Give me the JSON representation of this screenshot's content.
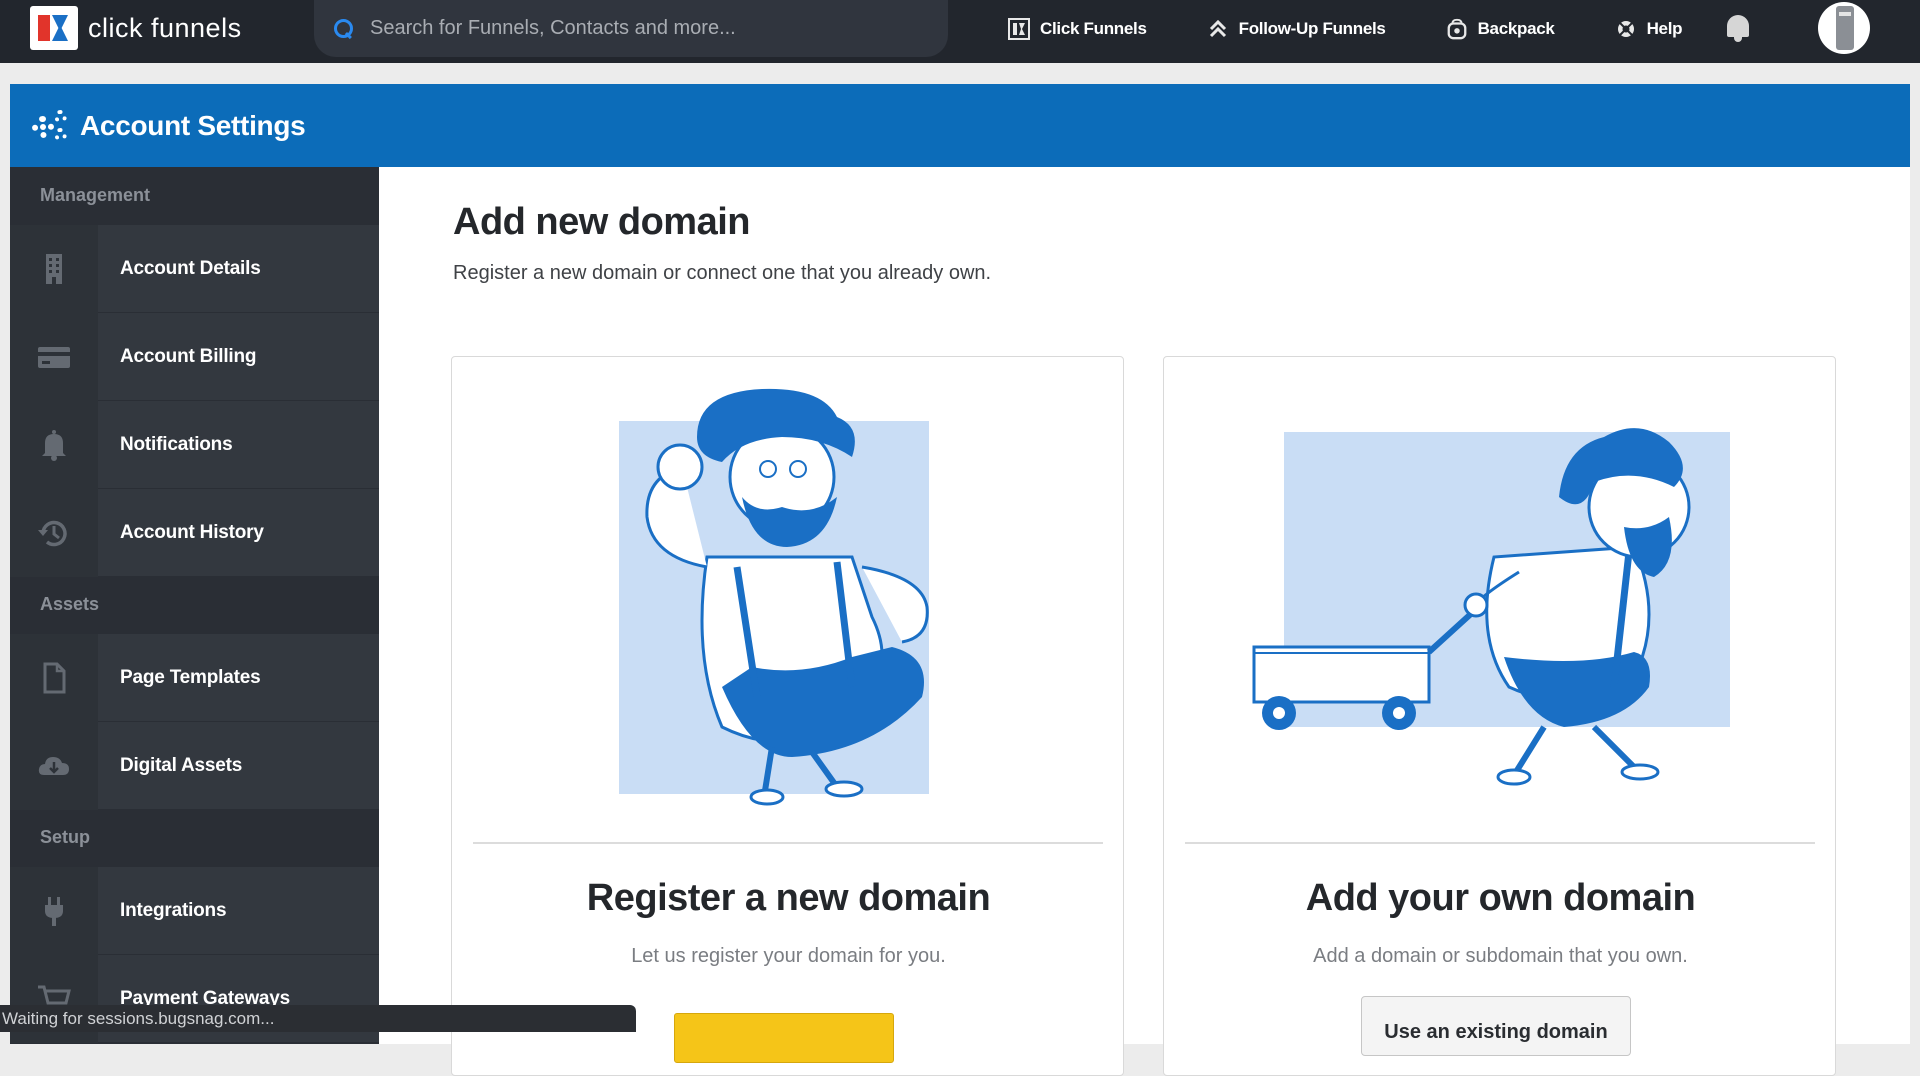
{
  "topbar": {
    "logo_text": "click funnels",
    "search_placeholder": "Search for Funnels, Contacts and more...",
    "nav": [
      {
        "label": "Click Funnels",
        "icon": "funnel-logo-icon"
      },
      {
        "label": "Follow-Up Funnels",
        "icon": "double-chevron-up-icon"
      },
      {
        "label": "Backpack",
        "icon": "backpack-icon"
      },
      {
        "label": "Help",
        "icon": "lifebuoy-icon"
      }
    ]
  },
  "header": {
    "title": "Account Settings",
    "icon": "gears-icon"
  },
  "sidebar": {
    "sections": [
      {
        "title": "Management",
        "items": [
          {
            "label": "Account Details",
            "icon": "building-icon"
          },
          {
            "label": "Account Billing",
            "icon": "credit-card-icon"
          },
          {
            "label": "Notifications",
            "icon": "bell-icon"
          },
          {
            "label": "Account History",
            "icon": "history-icon"
          }
        ]
      },
      {
        "title": "Assets",
        "items": [
          {
            "label": "Page Templates",
            "icon": "file-icon"
          },
          {
            "label": "Digital Assets",
            "icon": "cloud-download-icon"
          }
        ]
      },
      {
        "title": "Setup",
        "items": [
          {
            "label": "Integrations",
            "icon": "plug-icon"
          },
          {
            "label": "Payment Gateways",
            "icon": "cart-icon"
          }
        ]
      }
    ]
  },
  "main": {
    "title": "Add new domain",
    "subtitle": "Register a new domain or connect one that you already own.",
    "cards": [
      {
        "title": "Register a new domain",
        "description": "Let us register your domain for you.",
        "button": ""
      },
      {
        "title": "Add your own domain",
        "description": "Add a domain or subdomain that you own.",
        "button": "Use an existing domain"
      }
    ]
  },
  "status_bar": "Waiting for sessions.bugsnag.com...",
  "colors": {
    "topbar": "#22262d",
    "header": "#0c6cb9",
    "sidebar": "#2a2e35",
    "accent_blue": "#1a6fc5",
    "illustration_bg": "#c9ddf5",
    "button_yellow": "#f5c518"
  }
}
